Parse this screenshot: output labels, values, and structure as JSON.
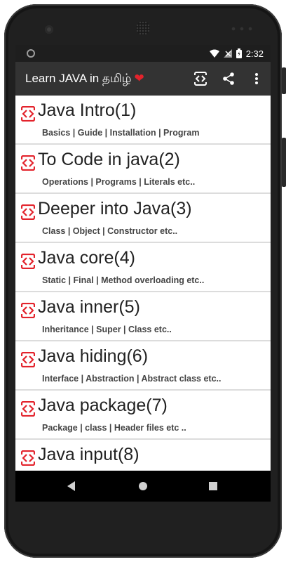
{
  "status": {
    "time": "2:32"
  },
  "app": {
    "title": "Learn JAVA in தமிழ்",
    "heart": "❤"
  },
  "items": [
    {
      "title": "Java Intro(1)",
      "subtitle": "Basics | Guide | Installation | Program"
    },
    {
      "title": "To Code in java(2)",
      "subtitle": "Operations | Programs | Literals etc.."
    },
    {
      "title": "Deeper into Java(3)",
      "subtitle": "Class | Object | Constructor etc.."
    },
    {
      "title": "Java core(4)",
      "subtitle": "Static | Final | Method overloading etc.."
    },
    {
      "title": "Java inner(5)",
      "subtitle": "Inheritance | Super | Class etc.."
    },
    {
      "title": "Java hiding(6)",
      "subtitle": "Interface | Abstraction | Abstract class etc.."
    },
    {
      "title": "Java package(7)",
      "subtitle": "Package | class | Header files etc .."
    },
    {
      "title": "Java input(8)",
      "subtitle": ""
    }
  ],
  "icons": {
    "item": "code-icon",
    "toolbar": [
      "code-view-icon",
      "share-icon",
      "more-vert-icon"
    ],
    "nav": [
      "back-icon",
      "home-icon",
      "recents-icon"
    ]
  },
  "colors": {
    "appbar": "#333333",
    "accent": "#e3232c",
    "statusbar": "#1e1e1e"
  }
}
